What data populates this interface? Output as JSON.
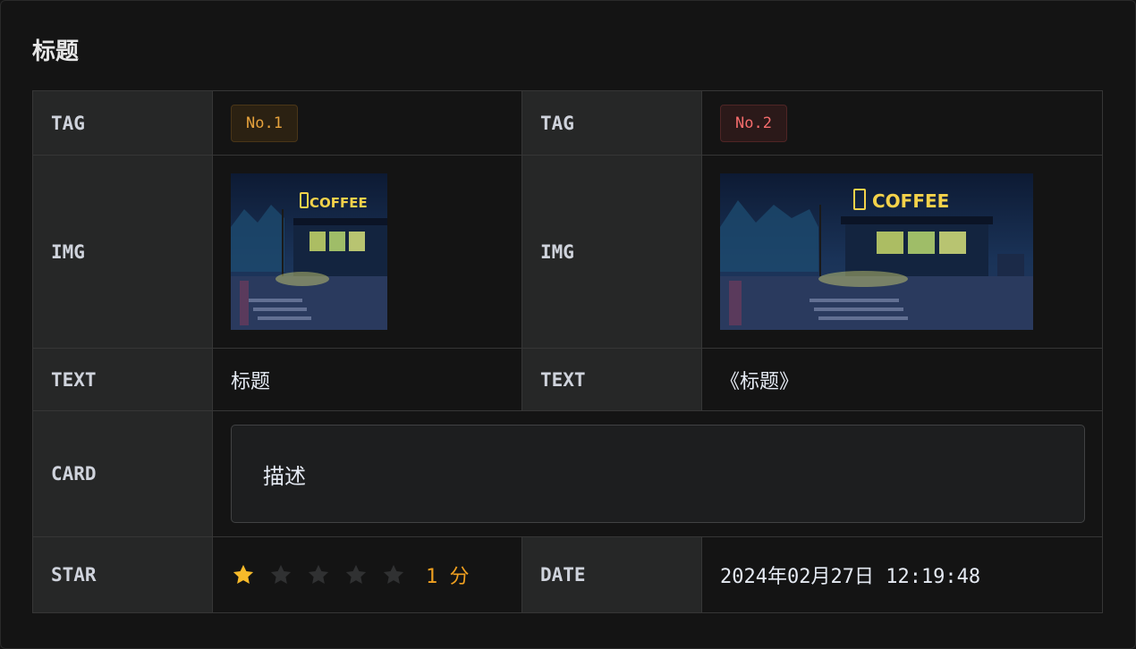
{
  "title": "标题",
  "rows": {
    "tag": {
      "label_left": "TAG",
      "label_right": "TAG",
      "tag_left": "No.1",
      "tag_right": "No.2"
    },
    "img": {
      "label_left": "IMG",
      "label_right": "IMG",
      "sign_text": "COFFEE"
    },
    "text": {
      "label_left": "TEXT",
      "label_right": "TEXT",
      "value_left": "标题",
      "value_right": "《标题》"
    },
    "card": {
      "label": "CARD",
      "text": "描述"
    },
    "star": {
      "label": "STAR",
      "rating": 1,
      "max": 5,
      "score_text": "1 分",
      "date_label": "DATE",
      "date_value": "2024年02月27日 12:19:48"
    }
  },
  "colors": {
    "star_on": "#f7ba2a",
    "star_off": "#303132",
    "tag_warn": "#e6a23c",
    "tag_danger": "#f56c6c"
  }
}
